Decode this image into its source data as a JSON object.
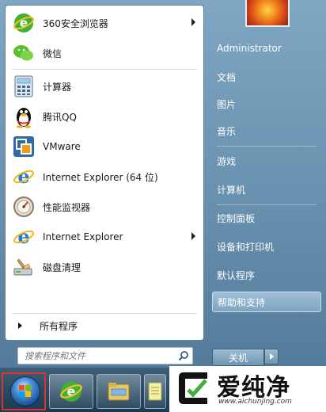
{
  "programs": [
    {
      "label": "360安全浏览器",
      "icon": "360-browser-icon",
      "submenu": true
    },
    {
      "label": "微信",
      "icon": "wechat-icon",
      "submenu": false
    },
    {
      "label": "计算器",
      "icon": "calculator-icon",
      "submenu": false
    },
    {
      "label": "腾讯QQ",
      "icon": "qq-penguin-icon",
      "submenu": false
    },
    {
      "label": "VMware",
      "icon": "vmware-icon",
      "submenu": false
    },
    {
      "label": "Internet Explorer (64 位)",
      "icon": "internet-explorer-icon",
      "submenu": false
    },
    {
      "label": "性能监视器",
      "icon": "performance-monitor-icon",
      "submenu": false
    },
    {
      "label": "Internet Explorer",
      "icon": "internet-explorer-icon",
      "submenu": true
    },
    {
      "label": "磁盘清理",
      "icon": "disk-cleanup-icon",
      "submenu": false
    }
  ],
  "all_programs_label": "所有程序",
  "search": {
    "placeholder": "搜索程序和文件",
    "value": ""
  },
  "right": {
    "user": "Administrator",
    "items": [
      "文档",
      "图片",
      "音乐",
      "游戏",
      "计算机",
      "控制面板",
      "设备和打印机",
      "默认程序",
      "帮助和支持"
    ],
    "highlighted": "帮助和支持",
    "shutdown_label": "关机"
  },
  "watermark": {
    "text": "爱纯净",
    "url": "www.aichunjing.com"
  },
  "colors": {
    "accent": "#e03030",
    "menu_blue": "#668fad",
    "taskbar": "#294b64"
  }
}
